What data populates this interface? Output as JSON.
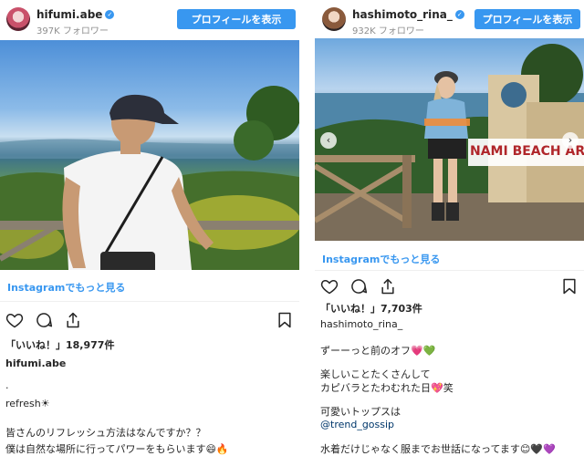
{
  "left_post": {
    "username": "hifumi.abe",
    "followers": "397K フォロワー",
    "profile_button": "プロフィールを表示",
    "instagram_link": "Instagramでもっと見る",
    "likes": "「いいね！」18,977件",
    "author": "hifumi.abe",
    "caption": [
      ".",
      "refresh☀",
      "",
      "皆さんのリフレッシュ方法はなんですか？？",
      "僕は自然な場所に行ってパワーをもらいます😄🔥"
    ]
  },
  "right_post": {
    "username": "hashimoto_rina_",
    "followers": "932K フォロワー",
    "profile_button": "プロフィールを表示",
    "instagram_link": "Instagramでもっと見る",
    "likes": "「いいね！」7,703件",
    "author": "hashimoto_rina_",
    "sign_text": "NAMI BEACH AREA",
    "caption": [
      "ずーーっと前のオフ💗💚",
      "",
      "楽しいことたくさんして",
      "カピバラとたわむれた日💖笑",
      "",
      "可愛いトップスは",
      "@trend_gossip",
      "",
      "水着だけじゃなく服までお世話になってます😊🖤💜"
    ]
  },
  "colors": {
    "accent": "#3897f0",
    "text": "#262626",
    "muted": "#8e8e8e",
    "link": "#00376b"
  }
}
